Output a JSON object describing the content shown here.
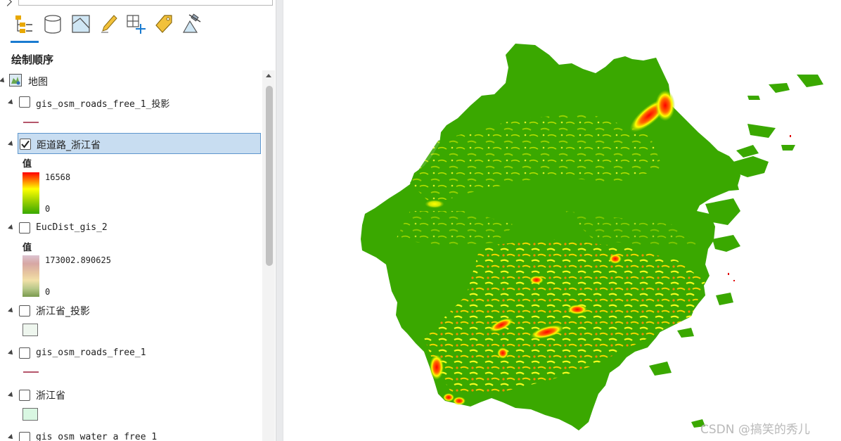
{
  "panel": {
    "title": "绘制顺序",
    "tools": [
      "list-by-drawing-order-icon",
      "list-by-source-icon",
      "list-by-selection-icon",
      "list-by-editing-icon",
      "list-by-snapping-icon",
      "list-by-labeling-icon",
      "list-by-perspective-imagery-icon"
    ]
  },
  "tree": {
    "root": {
      "label": "地图"
    },
    "layers": [
      {
        "label": "gis_osm_roads_free_1_投影",
        "checked": false,
        "symbol": "line"
      },
      {
        "label": "距道路_浙江省",
        "checked": true,
        "legend_title": "值",
        "max": "16568",
        "min": "0"
      },
      {
        "label": "EucDist_gis_2",
        "checked": false,
        "legend_title": "值",
        "max": "173002.890625",
        "min": "0"
      },
      {
        "label": "浙江省_投影",
        "checked": false,
        "symbol": "polygon"
      },
      {
        "label": "gis_osm_roads_free_1",
        "checked": false,
        "symbol": "line"
      },
      {
        "label": "浙江省",
        "checked": false,
        "symbol": "polygon"
      },
      {
        "label": "gis_osm_water_a_free_1",
        "checked": false
      }
    ]
  },
  "colors": {
    "ramp_high": "#ff0000",
    "ramp_mid": "#ffff00",
    "ramp_low": "#38a800",
    "map_base": "#3aa800",
    "selection": "#c8ddf1"
  },
  "watermark": "CSDN @搞笑的秀儿"
}
